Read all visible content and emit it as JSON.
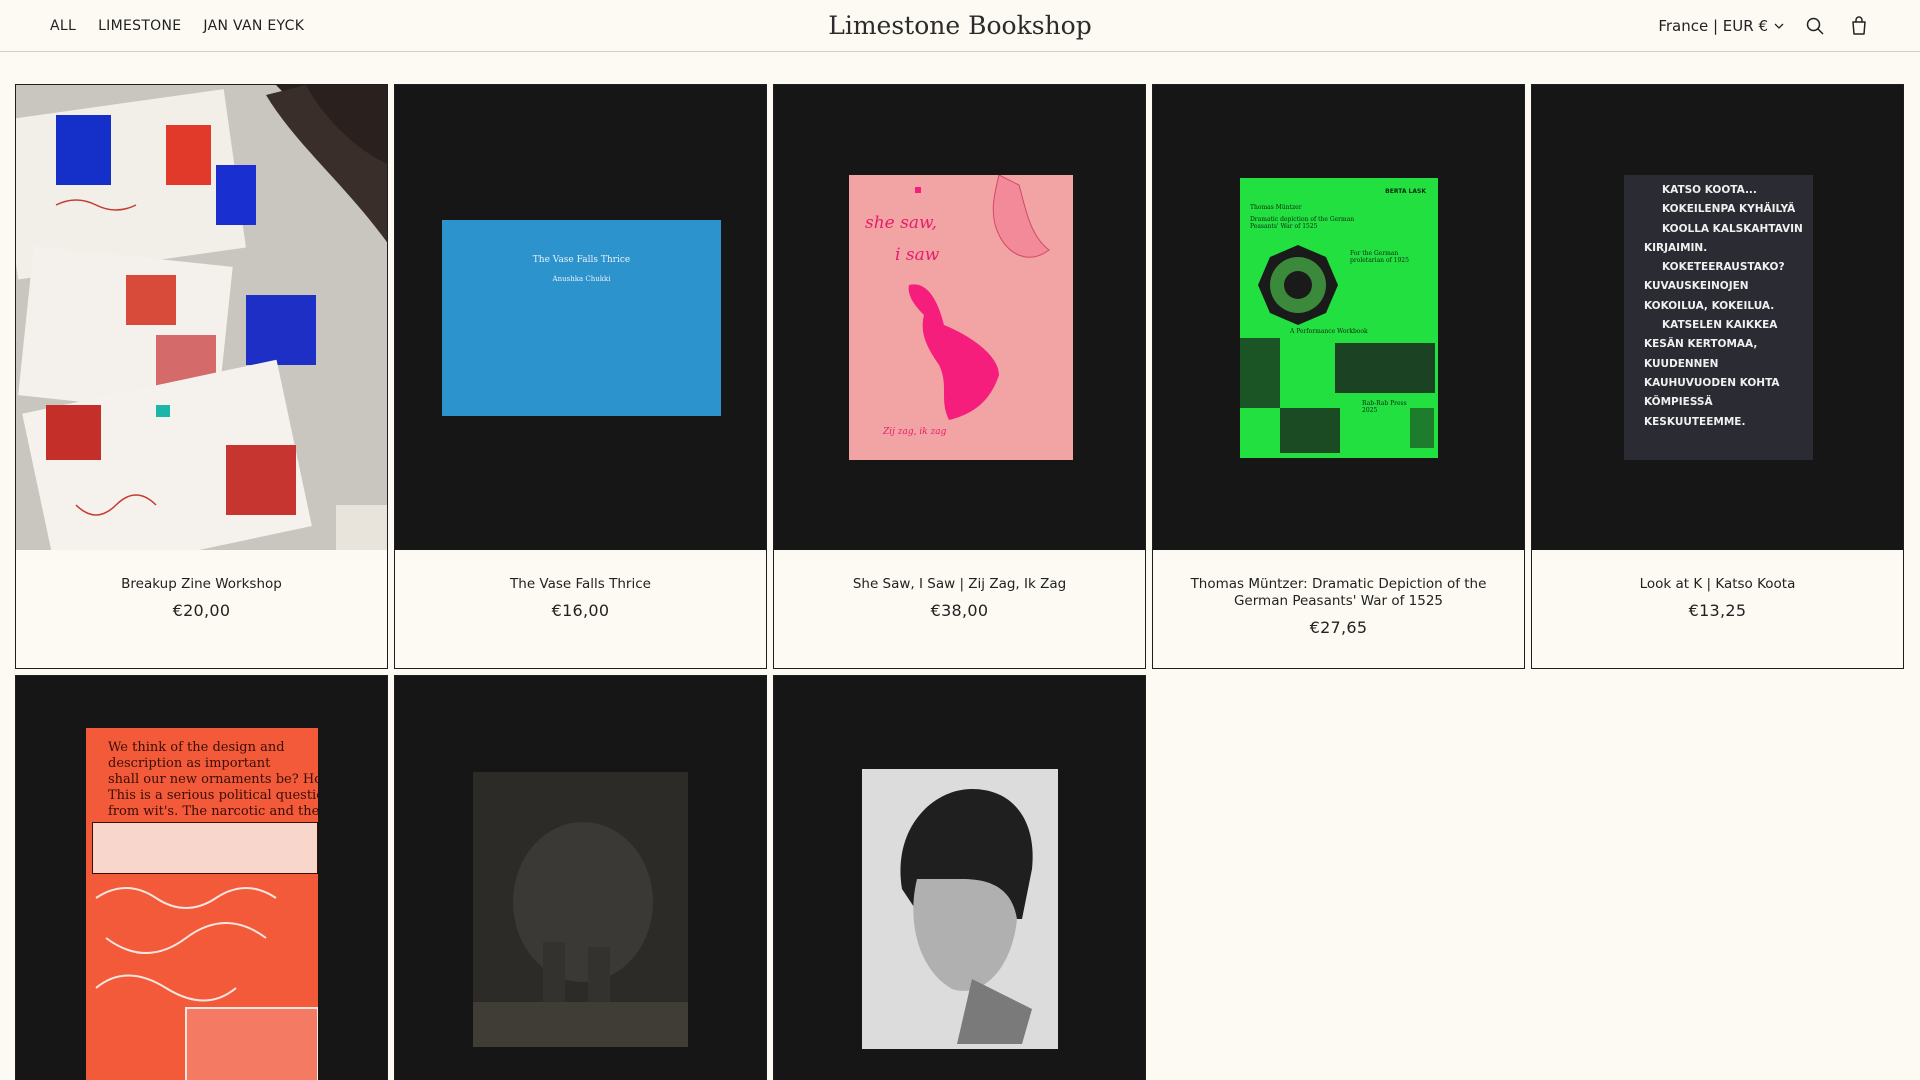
{
  "header": {
    "nav": [
      "ALL",
      "LIMESTONE",
      "JAN VAN EYCK"
    ],
    "logo": "Limestone Bookshop",
    "locale": "France | EUR €",
    "icons": {
      "search": "search-icon",
      "cart": "cart-icon",
      "chevron": "chevron-down-icon"
    }
  },
  "products": [
    {
      "title": "Breakup Zine Workshop",
      "price": "€20,00"
    },
    {
      "title": "The Vase Falls Thrice",
      "price": "€16,00",
      "cover_title": "The Vase Falls Thrice",
      "cover_author": "Anushka Chukki"
    },
    {
      "title": "She Saw, I Saw | Zij Zag, Ik Zag",
      "price": "€38,00",
      "cover_text_1": "she saw,",
      "cover_text_2": "i saw",
      "cover_text_3": "Zij zag, ik zag"
    },
    {
      "title": "Thomas Müntzer: Dramatic Depiction of the German Peasants' War of 1525",
      "price": "€27,65",
      "cover_author_label": "Thomas Müntzer",
      "cover_publisher_label": "BERTA LASK",
      "cover_sub": "Dramatic depiction of the German Peasants' War of 1525",
      "cover_side": "For the German proletarian of 1925",
      "cover_workbook": "A Performance Workbook",
      "cover_press": "Rab-Rab Press 2025"
    },
    {
      "title": "Look at K | Katso Koota",
      "price": "€13,25",
      "cover_lines": [
        "KATSO KOOTA...",
        "KOKEILENPA KYHÄILYÄ",
        "KOOLLA KALSKAHTAVIN",
        "KIRJAIMIN.",
        "KOKETEERAUSTAKO?",
        "KUVAUSKEINOJEN",
        "KOKOILUA, KOKEILUA.",
        "KATSELEN KAIKKEA",
        "KESÄN KERTOMAA,",
        "KUUDENNEN",
        "KAUHUVUODEN KOHTA",
        "KÖMPIESSÄ",
        "KESKUUTEEMME."
      ]
    },
    {
      "title": "",
      "price": "",
      "cover_lines": [
        "We think of the design and",
        "description as important",
        "shall our new ornaments be? How",
        "This is a serious political question",
        "from wit's. The narcotic and the"
      ]
    },
    {
      "title": "",
      "price": ""
    },
    {
      "title": "",
      "price": ""
    }
  ],
  "colors": {
    "bg": "#fcfaf3",
    "text": "#1e1e1e",
    "card_dark": "#161616",
    "blue": "#2d93cd",
    "pink": "#f2a3a3",
    "magenta": "#f51e7c",
    "green": "#22e040",
    "red": "#f25a3a"
  }
}
